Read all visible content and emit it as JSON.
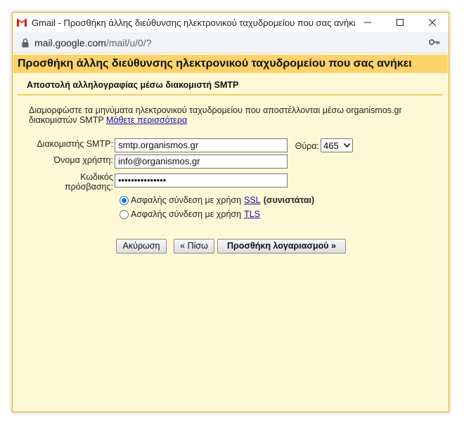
{
  "window": {
    "title": "Gmail - Προσθήκη άλλης διεύθυνσης ηλεκτρονικού ταχυδρομείου που σας ανήκει..."
  },
  "address_bar": {
    "host": "mail.google.com",
    "path": "/mail/u/0/?"
  },
  "page": {
    "header": "Προσθήκη άλλης διεύθυνσης ηλεκτρονικού ταχυδρομείου που σας ανήκει",
    "subheader": "Αποστολή αλληλογραφίας μέσω διακομιστή SMTP",
    "description_line1": "Διαμορφώστε τα μηνύματα ηλεκτρονικού ταχυδρομείου που αποστέλλονται μέσω organismos.gr",
    "description_line2": "διακομιστών SMTP",
    "learn_more": "Μάθετε περισσότερα"
  },
  "form": {
    "smtp_label": "Διακομιστής SMTP:",
    "smtp_value": "smtp.organismos.gr",
    "port_label": "Θύρα:",
    "port_value": "465",
    "username_label": "Όνομα χρήστη:",
    "username_value": "info@organismos.gr",
    "password_label_line1": "Κωδικός",
    "password_label_line2": "πρόσβασης:",
    "password_value": "•••••••••••••••",
    "ssl_option_prefix": "Ασφαλής σύνδεση με χρήση",
    "ssl_link": "SSL",
    "ssl_recommended": "(συνιστάται)",
    "ssl_selected": true,
    "tls_option_prefix": "Ασφαλής σύνδεση με χρήση",
    "tls_link": "TLS"
  },
  "buttons": {
    "cancel": "Ακύρωση",
    "back": "« Πίσω",
    "add_account": "Προσθήκη λογαριασμού »"
  },
  "colors": {
    "header_bg": "#ffd36b",
    "page_bg": "#fff8d6",
    "link": "#1a0dab",
    "gmail_red": "#ea4335"
  }
}
